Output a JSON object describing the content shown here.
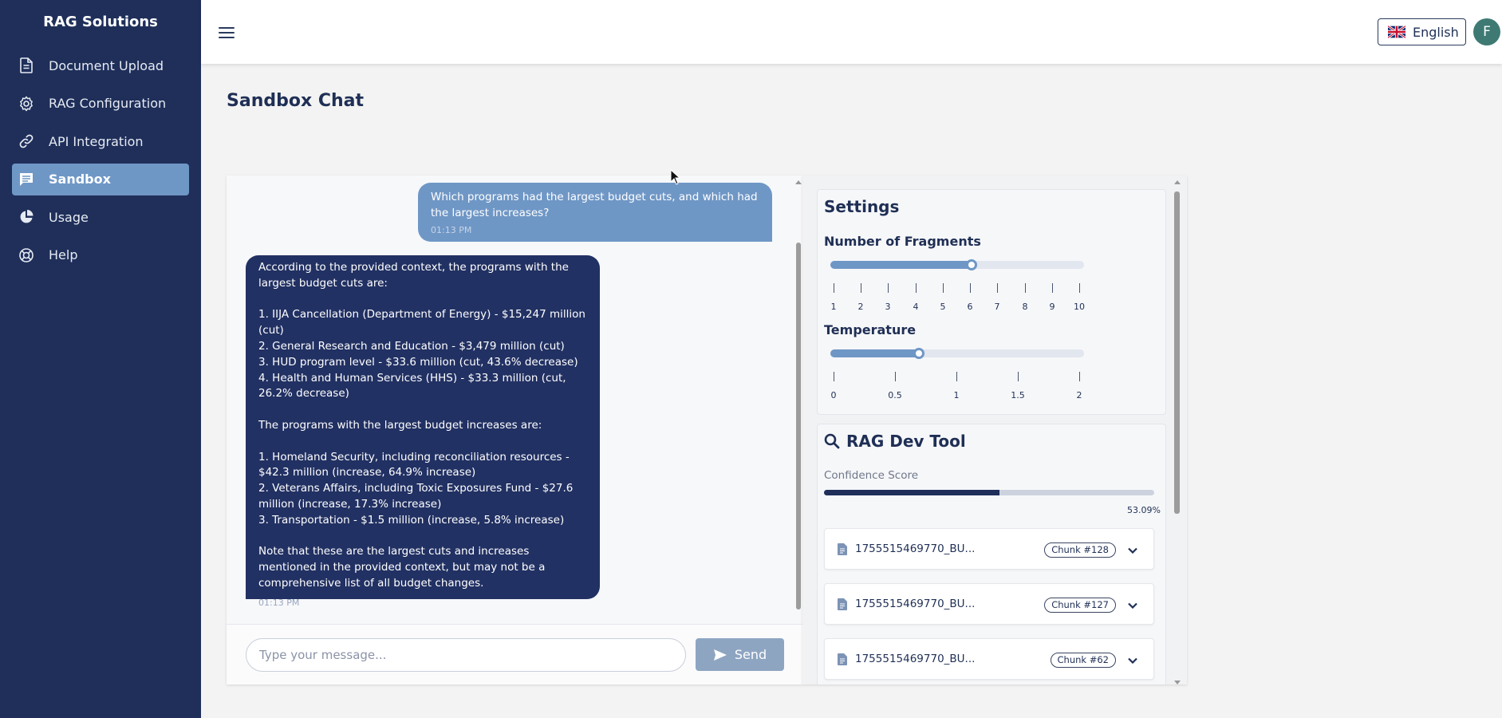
{
  "sidebar": {
    "brand": "RAG Solutions",
    "items": [
      {
        "label": "Document Upload",
        "icon": "document-icon"
      },
      {
        "label": "RAG Configuration",
        "icon": "gear-icon"
      },
      {
        "label": "API Integration",
        "icon": "link-icon"
      },
      {
        "label": "Sandbox",
        "icon": "chat-icon",
        "active": true
      },
      {
        "label": "Usage",
        "icon": "pie-chart-icon"
      },
      {
        "label": "Help",
        "icon": "lifebuoy-icon"
      }
    ]
  },
  "topbar": {
    "language": "English",
    "avatar_initial": "F"
  },
  "page": {
    "title": "Sandbox Chat"
  },
  "chat": {
    "user_message": {
      "text": "Which programs had the largest budget cuts, and which had the largest increases?",
      "time": "01:13 PM"
    },
    "bot_message": {
      "lines": [
        "According to the provided context, the programs with the largest budget cuts are:",
        "",
        "1. IIJA Cancellation (Department of Energy) - $15,247 million (cut)",
        "2. General Research and Education - $3,479 million (cut)",
        "3. HUD program level - $33.6 million (cut, 43.6% decrease)",
        "4. Health and Human Services (HHS) - $33.3 million (cut, 26.2% decrease)",
        "",
        "The programs with the largest budget increases are:",
        "",
        "1. Homeland Security, including reconciliation resources - $42.3 million (increase, 64.9% increase)",
        "2. Veterans Affairs, including Toxic Exposures Fund - $27.6 million (increase, 17.3% increase)",
        "3. Transportation - $1.5 million (increase, 5.8% increase)",
        "",
        "Note that these are the largest cuts and increases mentioned in the provided context, but may not be a comprehensive list of all budget changes."
      ],
      "time": "01:13 PM"
    },
    "input_placeholder": "Type your message...",
    "send_label": "Send"
  },
  "settings": {
    "title": "Settings",
    "fragments": {
      "label": "Number of Fragments",
      "value": 6,
      "min": 1,
      "max": 10,
      "ticks": [
        "1",
        "2",
        "3",
        "4",
        "5",
        "6",
        "7",
        "8",
        "9",
        "10"
      ]
    },
    "temperature": {
      "label": "Temperature",
      "value": 0.7,
      "min": 0,
      "max": 2,
      "ticks": [
        "0",
        "0.5",
        "1",
        "1.5",
        "2"
      ]
    }
  },
  "dev_tool": {
    "title": "RAG Dev Tool",
    "confidence_label": "Confidence Score",
    "confidence_value": "53.09%",
    "confidence_fraction": 0.5309,
    "chunks": [
      {
        "file": "1755515469770_BU...",
        "badge": "Chunk #128"
      },
      {
        "file": "1755515469770_BU...",
        "badge": "Chunk #127"
      },
      {
        "file": "1755515469770_BU...",
        "badge": "Chunk #62"
      }
    ]
  },
  "colors": {
    "sidebar_bg": "#1f2f5a",
    "accent": "#6f97c6",
    "bot_bubble": "#223163"
  }
}
